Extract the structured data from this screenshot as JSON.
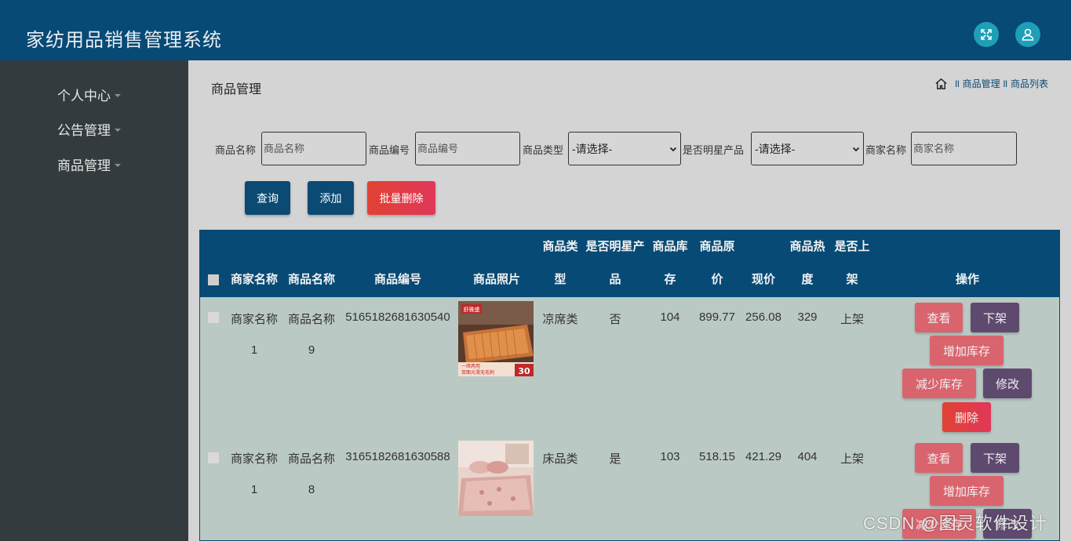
{
  "header": {
    "title": "家纺用品销售管理系统",
    "icons": [
      "fullscreen-icon",
      "user-icon"
    ]
  },
  "sidebar": {
    "items": [
      {
        "label": "个人中心"
      },
      {
        "label": "公告管理"
      },
      {
        "label": "商品管理"
      }
    ]
  },
  "page": {
    "title": "商品管理",
    "breadcrumb": {
      "sep": "ll",
      "items": [
        "商品管理",
        "商品列表"
      ]
    }
  },
  "filters": {
    "name": {
      "label": "商品名称",
      "placeholder": "商品名称"
    },
    "code": {
      "label": "商品编号",
      "placeholder": "商品编号"
    },
    "type": {
      "label": "商品类型",
      "value": "-请选择-"
    },
    "star": {
      "label": "是否明星产品",
      "value": "-请选择-"
    },
    "merchant": {
      "label": "商家名称",
      "placeholder": "商家名称"
    }
  },
  "actions": {
    "query": "查询",
    "add": "添加",
    "batch_delete": "批量删除"
  },
  "colors": {
    "header": "#074a75",
    "sidebar": "#343b3e",
    "query": "#0a4a73",
    "delete": "#e0384a",
    "view": "#d9646d",
    "edit": "#5e4a6e"
  },
  "table": {
    "headers": {
      "merchant": "商家名称",
      "name": "商品名称",
      "code": "商品编号",
      "photo": "商品照片",
      "type_1": "商品类",
      "type_2": "型",
      "star_1": "是否明星产",
      "star_2": "品",
      "stock_1": "商品库",
      "stock_2": "存",
      "orig_1": "商品原",
      "orig_2": "价",
      "price": "现价",
      "hot_1": "商品热",
      "hot_2": "度",
      "shelf_1": "是否上",
      "shelf_2": "架",
      "ops": "操作"
    },
    "row_actions": {
      "view": "查看",
      "unshelve": "下架",
      "add_stock": "增加库存",
      "reduce_stock": "减少库存",
      "edit": "修改",
      "delete": "删除"
    },
    "rows": [
      {
        "merchant_1": "商家名称",
        "merchant_2": "1",
        "name_1": "商品名称",
        "name_2": "9",
        "code": "5165182681630540",
        "type": "凉席类",
        "star": "否",
        "stock": "104",
        "orig": "899.77",
        "price": "256.08",
        "hot": "329",
        "shelf": "上架",
        "photo_text": [
          "舒雅盛",
          "一席两用",
          "双面光滑无毛刺",
          "30"
        ]
      },
      {
        "merchant_1": "商家名称",
        "merchant_2": "1",
        "name_1": "商品名称",
        "name_2": "8",
        "code": "3165182681630588",
        "type": "床品类",
        "star": "是",
        "stock": "103",
        "orig": "518.15",
        "price": "421.29",
        "hot": "404",
        "shelf": "上架"
      }
    ]
  },
  "watermark": "CSDN @图灵软件设计"
}
